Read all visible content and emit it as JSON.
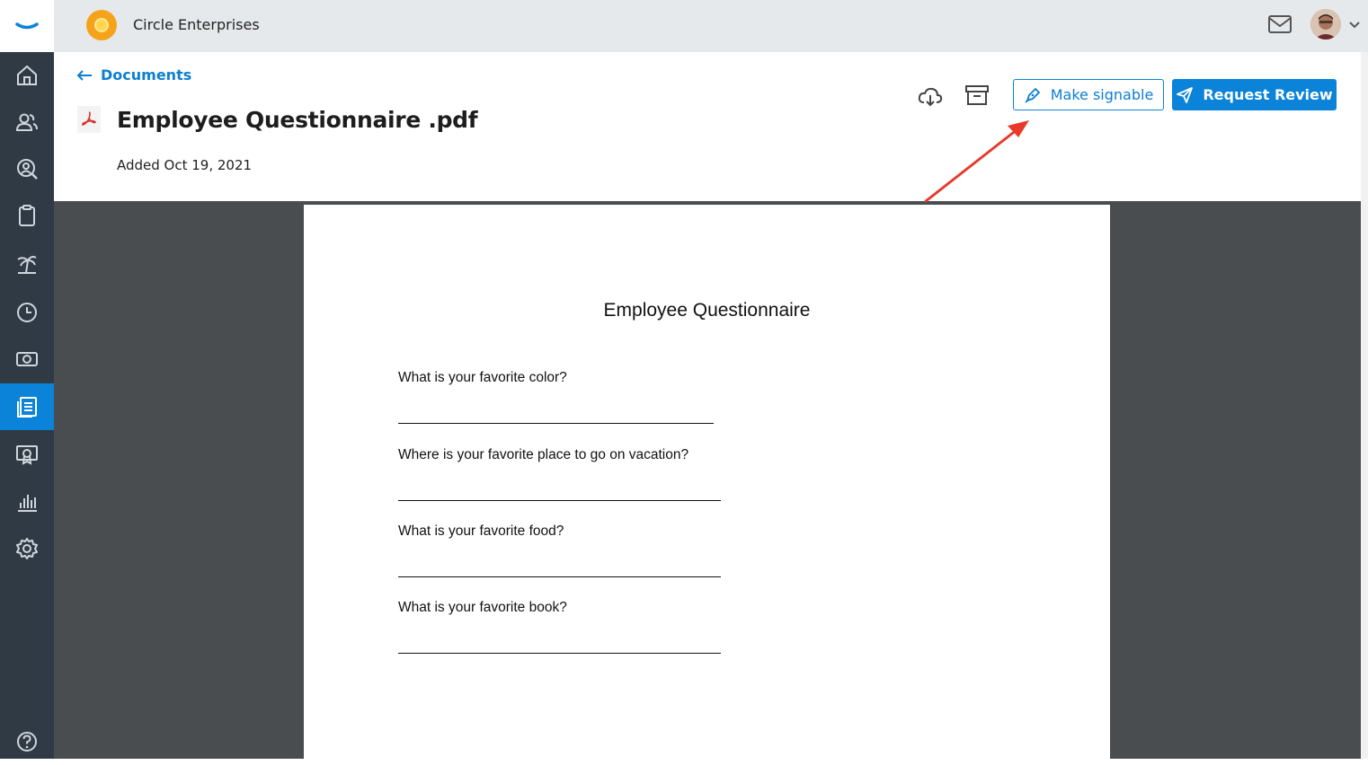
{
  "topbar": {
    "company_name": "Circle Enterprises"
  },
  "sidebar": {
    "items": [
      {
        "icon": "home-icon"
      },
      {
        "icon": "people-icon"
      },
      {
        "icon": "person-search-icon"
      },
      {
        "icon": "clipboard-icon"
      },
      {
        "icon": "palm-tree-icon"
      },
      {
        "icon": "clock-icon"
      },
      {
        "icon": "money-icon"
      },
      {
        "icon": "documents-icon",
        "active": true
      },
      {
        "icon": "certificate-icon"
      },
      {
        "icon": "bar-chart-icon"
      },
      {
        "icon": "gear-icon"
      }
    ],
    "help_icon": "help-icon"
  },
  "header": {
    "back_label": "Documents",
    "title": "Employee Questionnaire .pdf",
    "added": "Added Oct 19, 2021",
    "make_signable_label": "Make signable",
    "request_review_label": "Request Review"
  },
  "document": {
    "title": "Employee Questionnaire",
    "questions": [
      "What is your favorite color?",
      "Where is your favorite place to go on vacation?",
      "What is your favorite food?",
      "What is your favorite book?"
    ]
  },
  "colors": {
    "accent": "#0b83d9",
    "sidebar": "#2f3a45",
    "annotation_arrow": "#e8392a"
  }
}
